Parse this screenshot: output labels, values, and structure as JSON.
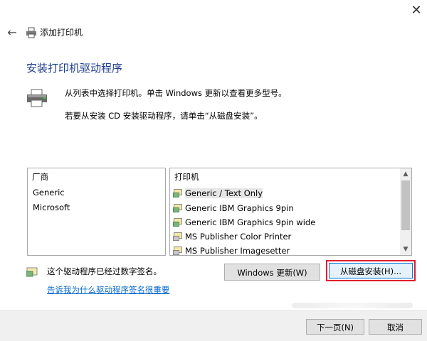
{
  "window": {
    "title": "添加打印机",
    "close_glyph": "✕",
    "back_glyph": "←"
  },
  "heading": "安装打印机驱动程序",
  "description": {
    "line1": "从列表中选择打印机。单击 Windows 更新以查看更多型号。",
    "line2": "若要从安装 CD 安装驱动程序，请单击“从磁盘安装”。"
  },
  "manufacturers": {
    "header": "厂商",
    "items": [
      "Generic",
      "Microsoft"
    ]
  },
  "printers": {
    "header": "打印机",
    "items": [
      {
        "label": "Generic / Text Only",
        "icon": "printer-green-icon",
        "selected": true
      },
      {
        "label": "Generic IBM Graphics 9pin",
        "icon": "printer-green-icon",
        "selected": false
      },
      {
        "label": "Generic IBM Graphics 9pin wide",
        "icon": "printer-green-icon",
        "selected": false
      },
      {
        "label": "MS Publisher Color Printer",
        "icon": "printer-gray-icon",
        "selected": false
      },
      {
        "label": "MS Publisher Imagesetter",
        "icon": "printer-gray-icon",
        "selected": false
      }
    ],
    "scroll_up": "▲",
    "scroll_down": "▼"
  },
  "signed": {
    "text": "这个驱动程序已经过数字签名。",
    "link": "告诉我为什么驱动程序签名很重要"
  },
  "buttons": {
    "windows_update": "Windows 更新(W)",
    "have_disk": "从磁盘安装(H)...",
    "next": "下一页(N)",
    "cancel": "取消"
  },
  "colors": {
    "heading": "#1e3c8c",
    "link": "#0066cc",
    "highlight_outline": "#e0202e"
  }
}
